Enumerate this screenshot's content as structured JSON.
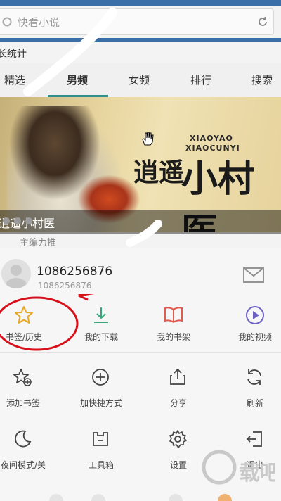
{
  "search": {
    "placeholder": "快看小说"
  },
  "stats_label": "长统计",
  "tabs": [
    "精选",
    "男频",
    "女频",
    "排行",
    "搜索"
  ],
  "banner": {
    "latin_line1": "XIAOYAO",
    "latin_line2": "XIAOCUNYI",
    "title_small": "逍遥",
    "title_big": "小村医",
    "caption": "逍遥小村医"
  },
  "below_banner_text": "主编力推",
  "user": {
    "name": "1086256876",
    "id": "1086256876"
  },
  "quick_actions": [
    {
      "label": "书签/历史",
      "icon": "star-icon",
      "color": "#e7a825"
    },
    {
      "label": "我的下载",
      "icon": "download-icon",
      "color": "#35a77a"
    },
    {
      "label": "我的书架",
      "icon": "book-icon",
      "color": "#e05a4e"
    },
    {
      "label": "我的视频",
      "icon": "play-icon",
      "color": "#6c62c4"
    }
  ],
  "menu_row1": [
    {
      "label": "添加书签",
      "icon": "star-add-icon"
    },
    {
      "label": "加快捷方式",
      "icon": "plus-circle-icon"
    },
    {
      "label": "分享",
      "icon": "share-icon"
    },
    {
      "label": "刷新",
      "icon": "refresh-icon"
    }
  ],
  "menu_row2": [
    {
      "label": "夜间模式/关",
      "icon": "moon-icon"
    },
    {
      "label": "工具箱",
      "icon": "toolbox-icon"
    },
    {
      "label": "设置",
      "icon": "gear-icon"
    },
    {
      "label": "退出",
      "icon": "exit-icon"
    }
  ],
  "watermark": {
    "text": "下载吧"
  },
  "colors": {
    "accent": "#2f8f8b",
    "annotation": "#d8101c",
    "topbar": "#3a6fa8"
  }
}
